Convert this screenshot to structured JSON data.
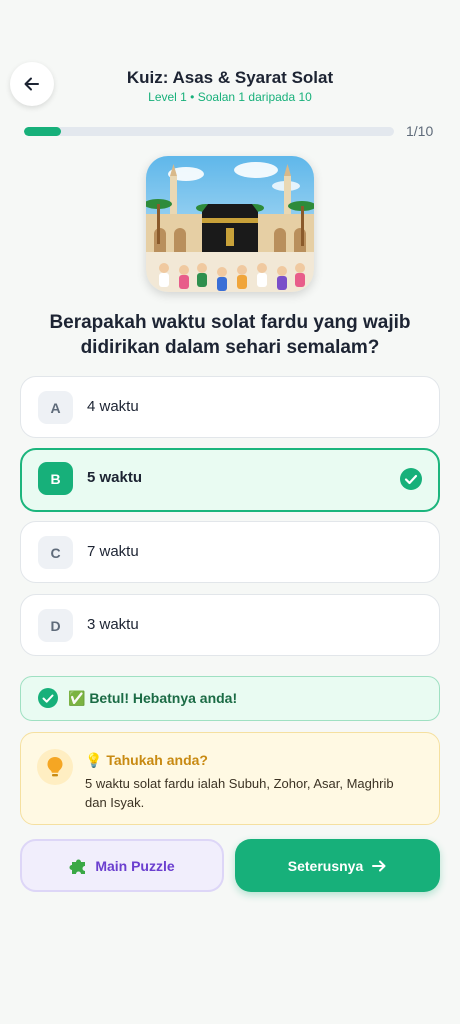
{
  "header": {
    "title": "Kuiz: Asas & Syarat Solat",
    "subtitle": "Level 1 • Soalan 1 daripada 10"
  },
  "progress": {
    "label": "1/10",
    "fraction": 0.1
  },
  "hero": {
    "image": "kaaba-illustration"
  },
  "question": "Berapakah waktu solat fardu yang wajib didirikan dalam sehari semalam?",
  "options": [
    {
      "letter": "A",
      "text": "4 waktu",
      "selected": false
    },
    {
      "letter": "B",
      "text": "5 waktu",
      "selected": true
    },
    {
      "letter": "C",
      "text": "7 waktu",
      "selected": false
    },
    {
      "letter": "D",
      "text": "3 waktu",
      "selected": false
    }
  ],
  "feedback": {
    "text": "✅ Betul! Hebatnya anda!"
  },
  "tip": {
    "title": "💡 Tahukah anda?",
    "body": "5 waktu solat fardu ialah Subuh, Zohor, Asar, Maghrib dan Isyak."
  },
  "buttons": {
    "puzzle": "Main Puzzle",
    "next": "Seterusnya"
  },
  "colors": {
    "accent": "#17b07a",
    "puzzle": "#6b3fcf",
    "tip": "#c88a12"
  }
}
